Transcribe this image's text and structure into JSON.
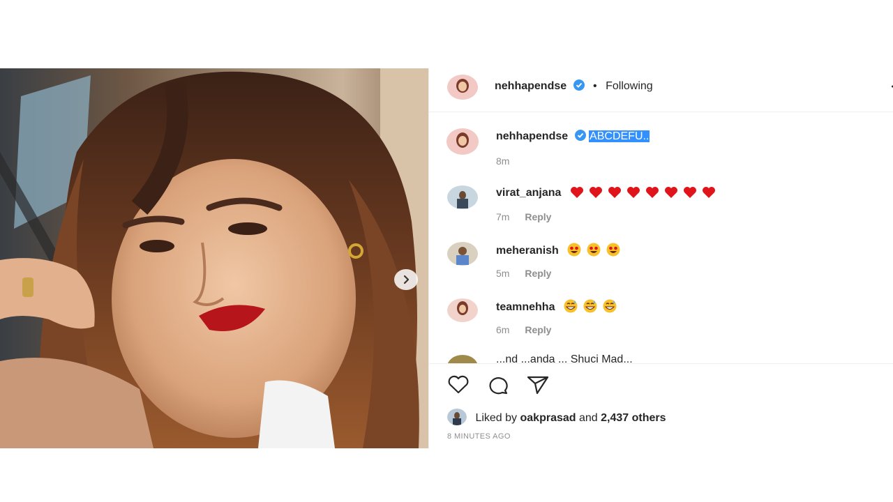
{
  "post": {
    "author": "nehhapendse",
    "follow_status": "Following",
    "separator": "•"
  },
  "caption": {
    "username": "nehhapendse",
    "text": "ABCDEFU..",
    "time": "8m"
  },
  "comments": [
    {
      "username": "virat_anjana",
      "emoji": "red-heart",
      "emoji_count": 8,
      "time": "7m",
      "reply": "Reply"
    },
    {
      "username": "meheranish",
      "emoji": "star-struck",
      "emoji_count": 3,
      "time": "5m",
      "reply": "Reply"
    },
    {
      "username": "teamnehha",
      "emoji": "grinning-sweat",
      "emoji_count": 3,
      "time": "6m",
      "reply": "Reply"
    }
  ],
  "partial_comment": {
    "text": "...nd ...anda ... Shuci Mad..."
  },
  "likes": {
    "prefix": "Liked by",
    "user": "oakprasad",
    "middle": "and",
    "others": "2,437 others"
  },
  "timestamp": "8 MINUTES AGO",
  "colors": {
    "verified": "#3897f0",
    "highlight": "#3390ff",
    "muted": "#8e8e8e",
    "heart": "#e0151b"
  }
}
